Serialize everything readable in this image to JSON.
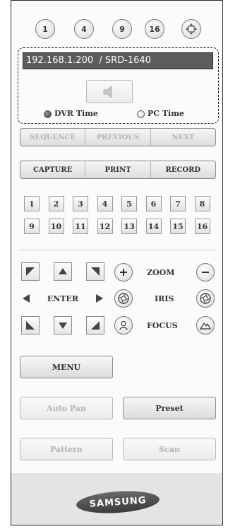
{
  "view_buttons": [
    "1",
    "4",
    "9",
    "16"
  ],
  "connection": {
    "text": "192.168.1.200  / SRD-1640"
  },
  "time_options": {
    "dvr": "DVR Time",
    "pc": "PC Time"
  },
  "nav_buttons": {
    "sequence": "SEQUENCE",
    "previous": "PREVIOUS",
    "next": "NEXT"
  },
  "action_buttons": {
    "capture": "CAPTURE",
    "print": "PRINT",
    "record": "RECORD"
  },
  "channels": [
    "1",
    "2",
    "3",
    "4",
    "5",
    "6",
    "7",
    "8",
    "9",
    "10",
    "11",
    "12",
    "13",
    "14",
    "15",
    "16"
  ],
  "ptz": {
    "enter": "ENTER",
    "zoom": "ZOOM",
    "iris": "IRIS",
    "focus": "FOCUS"
  },
  "buttons": {
    "menu": "MENU",
    "auto_pan": "Auto Pan",
    "preset": "Preset",
    "pattern": "Pattern",
    "scan": "Scan"
  },
  "brand": {
    "logo": "SAMSUNG"
  }
}
